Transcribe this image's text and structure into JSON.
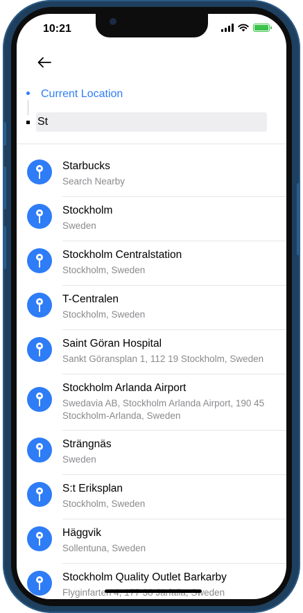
{
  "status_bar": {
    "time": "10:21"
  },
  "header": {
    "origin_label": "Current Location",
    "search_value": "St"
  },
  "results": [
    {
      "title": "Starbucks",
      "subtitle": "Search Nearby"
    },
    {
      "title": "Stockholm",
      "subtitle": "Sweden"
    },
    {
      "title": "Stockholm Centralstation",
      "subtitle": "Stockholm, Sweden"
    },
    {
      "title": "T-Centralen",
      "subtitle": "Stockholm, Sweden"
    },
    {
      "title": "Saint Göran Hospital",
      "subtitle": "Sankt Göransplan 1, 112 19 Stockholm, Sweden"
    },
    {
      "title": "Stockholm Arlanda Airport",
      "subtitle": "Swedavia AB, Stockholm Arlanda Airport, 190 45 Stockholm-Arlanda, Sweden"
    },
    {
      "title": "Strängnäs",
      "subtitle": "Sweden"
    },
    {
      "title": "S:t Eriksplan",
      "subtitle": "Stockholm, Sweden"
    },
    {
      "title": "Häggvik",
      "subtitle": "Sollentuna, Sweden"
    },
    {
      "title": "Stockholm Quality Outlet Barkarby",
      "subtitle": "Flyginfarten 4, 177 38 Järfälla, Sweden"
    }
  ],
  "colors": {
    "accent": "#2e7cf6",
    "frame": "#1e3f5e",
    "battery": "#3ac34b"
  },
  "icons": {
    "back": "arrow-left-icon",
    "result": "location-pin-icon"
  }
}
